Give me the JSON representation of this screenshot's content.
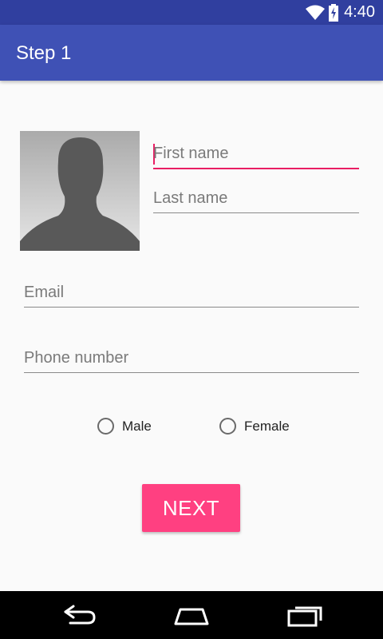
{
  "status_bar": {
    "time": "4:40",
    "icons": [
      "wifi-icon",
      "battery-charging-icon"
    ]
  },
  "app_bar": {
    "title": "Step 1"
  },
  "form": {
    "avatar": "person-silhouette-icon",
    "first_name_placeholder": "First name",
    "last_name_placeholder": "Last name",
    "email_placeholder": "Email",
    "phone_placeholder": "Phone number",
    "gender_options": [
      "Male",
      "Female"
    ],
    "next_label": "NEXT"
  },
  "nav_bar": {
    "icons": [
      "back-icon",
      "home-icon",
      "recents-icon"
    ]
  },
  "colors": {
    "primary": "#3f51b5",
    "primary_dark": "#303f9f",
    "accent": "#ff4081",
    "focus_underline": "#e91e63"
  }
}
